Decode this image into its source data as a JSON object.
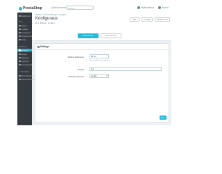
{
  "topbar": {
    "logo_text": "PrestaShop",
    "quick_access": "Quick Access ▾",
    "search_placeholder": "Search",
    "notifications": "Notifications",
    "account": "Admin"
  },
  "sidebar": {
    "dashboard": "Dashboard",
    "sections": [
      {
        "title": "SELL",
        "items": [
          "Orders",
          "Catalog",
          "Customers",
          "Customer Service",
          "Stats"
        ]
      },
      {
        "title": "IMPROVE",
        "items": [
          "Modules",
          "Design",
          "Shipping",
          "Payment",
          "International"
        ]
      },
      {
        "title": "CONFIGURE",
        "items": [
          "Shop Parameters",
          "Advanced Parameters"
        ]
      }
    ]
  },
  "header": {
    "breadcrumb": "Modules  /  Module Manager  /  Configure",
    "title": "Konfigurace",
    "subtitle": "Hot. Zabezp. Dodání",
    "toolbar": [
      "Back",
      "Translate",
      "Manage hooks"
    ],
    "primary_button": "Save and stay",
    "secondary_button": "Download CSV"
  },
  "panel": {
    "title": "Settings",
    "fields": [
      {
        "label": "Starting Reference",
        "value": "25 ms",
        "help": "Use a suitable order reference"
      },
      {
        "label": "Priority",
        "value": "1.0",
        "help": ""
      },
      {
        "label": "Change frequency",
        "value": "weekly",
        "help": ""
      }
    ],
    "save_label": "Save"
  },
  "colors": {
    "accent": "#25b9d7",
    "sidebar_bg": "#363a41",
    "page_bg": "#eef1f4"
  }
}
